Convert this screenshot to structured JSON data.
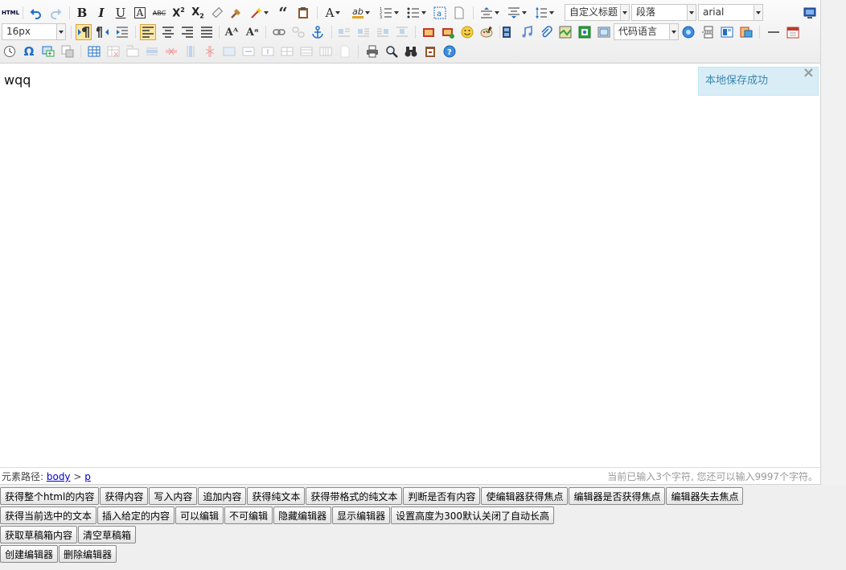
{
  "toolbar": {
    "html_label": "HTML",
    "bold": "B",
    "italic": "I",
    "underline": "U",
    "font_border": "A",
    "strike": "ABC",
    "superscript": "X",
    "superscript_mark": "2",
    "subscript": "X",
    "subscript_mark": "2",
    "font_color": "A",
    "backcolor": "ab",
    "custom_style": "自定义标题",
    "paragraph": "段落",
    "font_family": "arial",
    "font_size": "16px",
    "code_language": "代码语言",
    "omega": "Ω"
  },
  "content": {
    "text": "wqq"
  },
  "notice": {
    "text": "本地保存成功",
    "close": "×"
  },
  "status": {
    "path_label": "元素路径: ",
    "path_body": "body",
    "path_sep": " > ",
    "path_p": "p",
    "count_text": "当前已输入3个字符, 您还可以输入9997个字符。"
  },
  "buttons": {
    "row1": [
      "获得整个html的内容",
      "获得内容",
      "写入内容",
      "追加内容",
      "获得纯文本",
      "获得带格式的纯文本",
      "判断是否有内容",
      "使编辑器获得焦点",
      "编辑器是否获得焦点",
      "编辑器失去焦点"
    ],
    "row2": [
      "获得当前选中的文本",
      "插入给定的内容",
      "可以编辑",
      "不可编辑",
      "隐藏编辑器",
      "显示编辑器",
      "设置高度为300默认关闭了自动长高"
    ],
    "row3": [
      "获取草稿箱内容",
      "清空草稿箱"
    ],
    "row4": [
      "创建编辑器",
      "删除编辑器"
    ]
  }
}
